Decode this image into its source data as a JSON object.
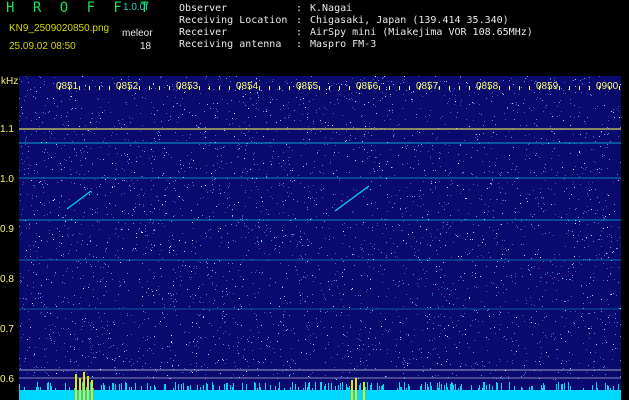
{
  "header": {
    "app_title": "H R O F F T",
    "version": "1.0.0f",
    "filename": "KN9_2509020850.png",
    "datetime": "25.09.02 08:50",
    "mode_label": "meleor",
    "mode_value": "18"
  },
  "station_info": [
    {
      "key": "Observer",
      "value": "K.Nagai"
    },
    {
      "key": "Receiving Location",
      "value": "Chigasaki, Japan (139.414 35.340)"
    },
    {
      "key": "Receiver",
      "value": "AirSpy mini (Miakejima VOR 108.65MHz)"
    },
    {
      "key": "Receiving antenna",
      "value": "Maspro FM-3"
    }
  ],
  "spectrogram": {
    "unit": "kHz",
    "time_labels": [
      "0851",
      "0852",
      "0853",
      "0854",
      "0855",
      "0856",
      "0857",
      "0858",
      "0859",
      "0900"
    ],
    "freq_labels": [
      "1.1",
      "1.0",
      "0.9",
      "0.8",
      "0.7",
      "0.6"
    ],
    "colors": {
      "background": "#0a0a6e",
      "signal": "#00e6ff",
      "strong": "#e0e060",
      "labels": "#f5f570"
    }
  }
}
